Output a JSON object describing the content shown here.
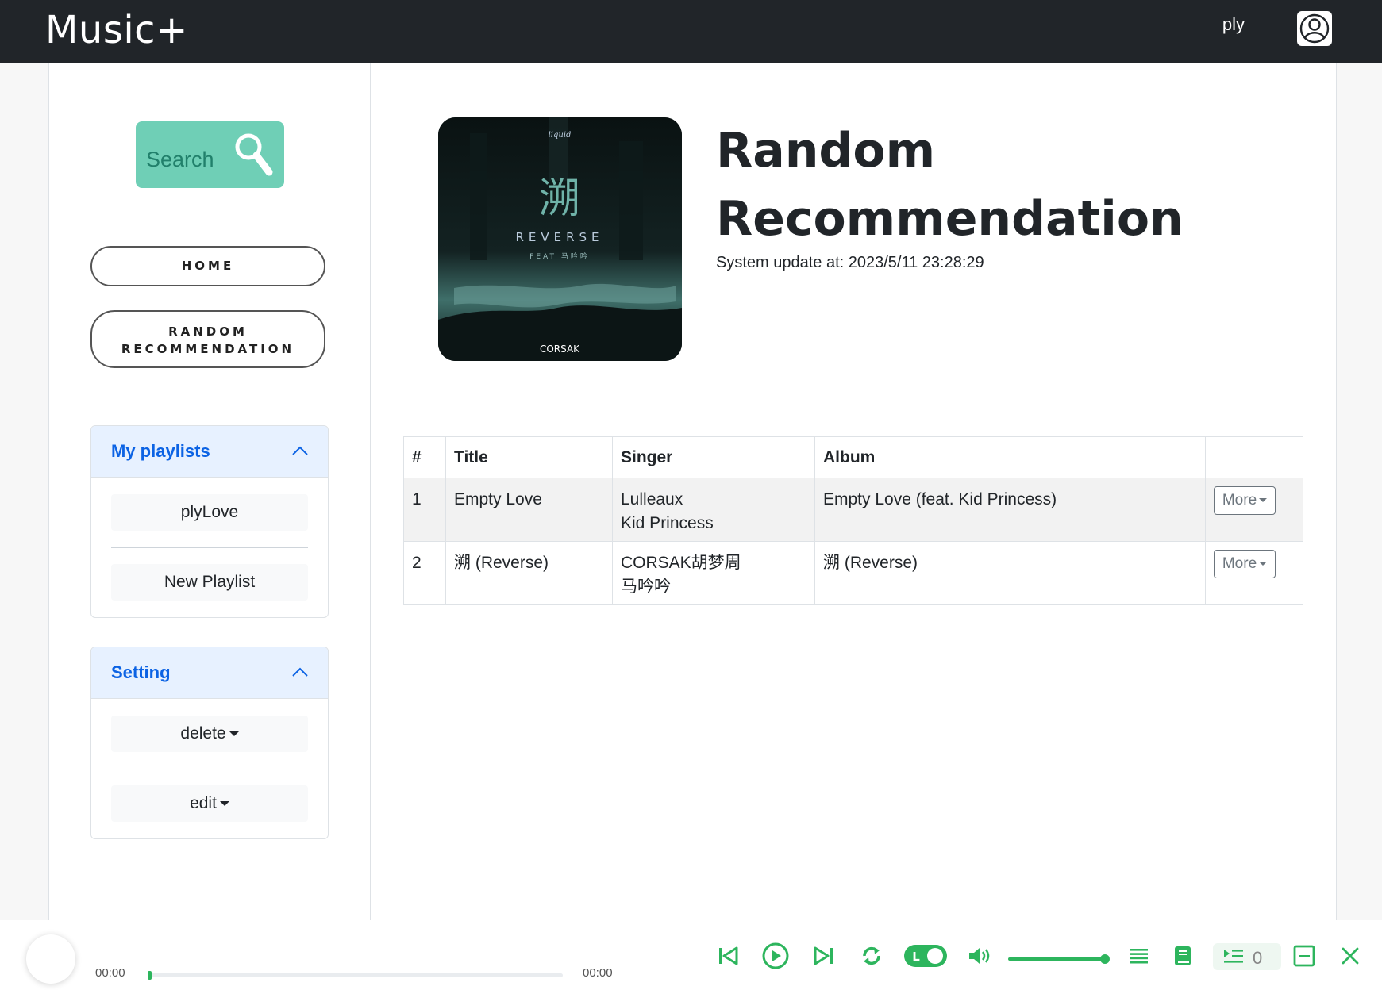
{
  "app": {
    "brand": "Music+",
    "user_name": "ply",
    "accent_color": "#2db55d",
    "search_color": "#6fcfb6"
  },
  "sidebar": {
    "search_label": "Search",
    "nav": [
      {
        "label": "HOME"
      },
      {
        "label": "RANDOM RECOMMENDATION",
        "lines": [
          "RANDOM",
          "RECOMMENDATION"
        ]
      }
    ],
    "playlists": {
      "title": "My playlists",
      "items": [
        "plyLove",
        "New Playlist"
      ]
    },
    "setting": {
      "title": "Setting",
      "items": [
        "delete",
        "edit"
      ]
    }
  },
  "main": {
    "title_lines": [
      "Random",
      "Recommendation"
    ],
    "update_text": "System update at: 2023/5/11 23:28:29",
    "cover": {
      "label_top": "liquid",
      "glyph": "溯",
      "title": "REVERSE",
      "feat": "FEAT 马吟吟",
      "artist": "CORSAK"
    },
    "table": {
      "headers": [
        "#",
        "Title",
        "Singer",
        "Album",
        ""
      ],
      "rows": [
        {
          "num": "1",
          "title": "Empty Love",
          "singers": [
            "Lulleaux",
            "Kid Princess"
          ],
          "album": "Empty Love (feat. Kid Princess)",
          "action": "More"
        },
        {
          "num": "2",
          "title": "溯 (Reverse)",
          "singers": [
            "CORSAK胡梦周",
            "马吟吟"
          ],
          "album": "溯 (Reverse)",
          "action": "More"
        }
      ]
    }
  },
  "player": {
    "time_current": "00:00",
    "time_total": "00:00",
    "progress": 0,
    "volume": 1.0,
    "queue_count": "0",
    "mode_toggle": "L",
    "icons": [
      "skip-back-icon",
      "play-icon",
      "skip-forward-icon",
      "repeat-icon",
      "mode-toggle-icon",
      "volume-icon",
      "list-icon",
      "lyrics-book-icon",
      "queue-icon",
      "minimize-icon",
      "close-icon"
    ]
  }
}
